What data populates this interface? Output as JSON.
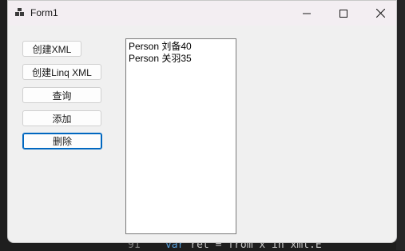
{
  "window": {
    "title": "Form1"
  },
  "buttons": {
    "create_xml": "创建XML",
    "create_linq_xml": "创建Linq XML",
    "query": "查询",
    "add": "添加",
    "delete": "删除"
  },
  "list": {
    "items": [
      {
        "label": "Person 刘备40"
      },
      {
        "label": "Person 关羽35"
      }
    ]
  },
  "background": {
    "line_number": "91",
    "code_prefix": "var",
    "code_rest": " ret = from x in xml.E"
  }
}
